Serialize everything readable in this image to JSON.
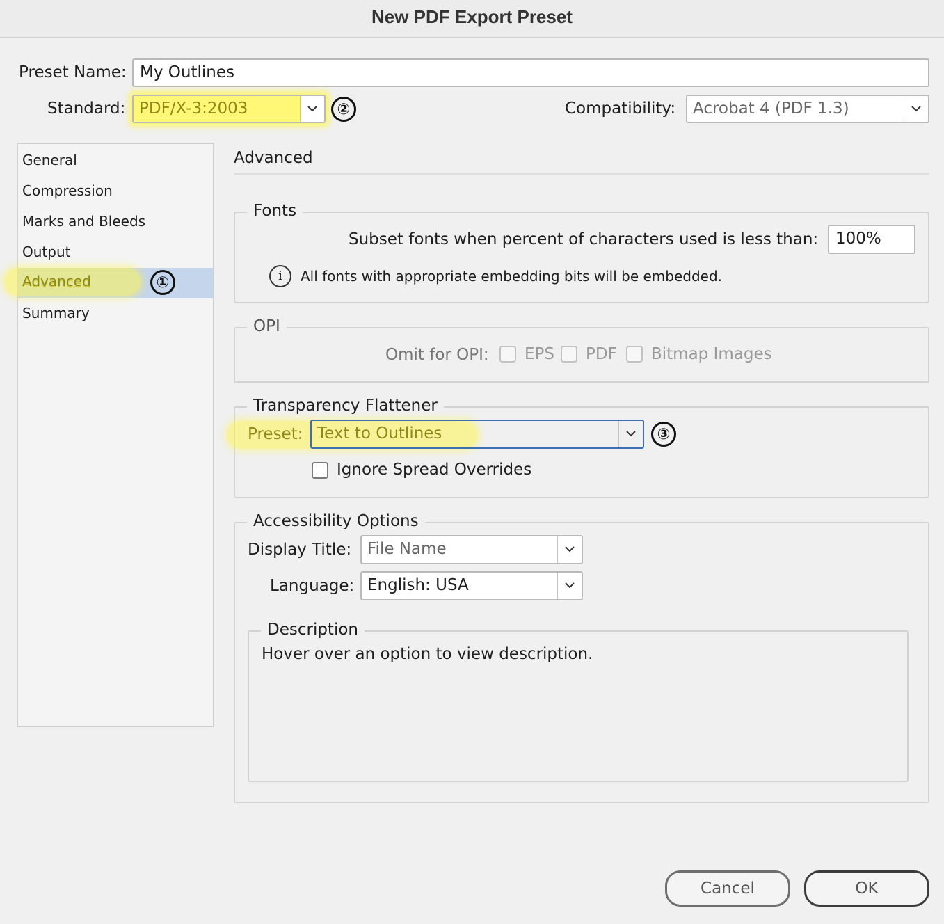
{
  "window": {
    "title": "New PDF Export Preset"
  },
  "preset_name": {
    "label": "Preset Name:",
    "value": "My Outlines"
  },
  "standard": {
    "label": "Standard:",
    "value": "PDF/X-3:2003",
    "badge": "②"
  },
  "compatibility": {
    "label": "Compatibility:",
    "value": "Acrobat 4 (PDF 1.3)"
  },
  "sidebar": {
    "items": [
      {
        "label": "General"
      },
      {
        "label": "Compression"
      },
      {
        "label": "Marks and Bleeds"
      },
      {
        "label": "Output"
      },
      {
        "label": "Advanced",
        "badge": "①",
        "selected": true
      },
      {
        "label": "Summary"
      }
    ]
  },
  "panel": {
    "heading": "Advanced"
  },
  "fonts": {
    "legend": "Fonts",
    "subset_label": "Subset fonts when percent of characters used is less than:",
    "subset_value": "100%",
    "info_text": "All fonts with appropriate embedding bits will be embedded.",
    "info_icon": "info-icon"
  },
  "opi": {
    "legend": "OPI",
    "omit_label": "Omit for OPI:",
    "options": [
      {
        "label": "EPS",
        "checked": false
      },
      {
        "label": "PDF",
        "checked": false
      },
      {
        "label": "Bitmap Images",
        "checked": false
      }
    ]
  },
  "transparency": {
    "legend": "Transparency Flattener",
    "preset_label": "Preset:",
    "preset_value": "Text to Outlines",
    "badge": "③",
    "ignore_label": "Ignore Spread Overrides",
    "ignore_checked": false
  },
  "accessibility": {
    "legend": "Accessibility Options",
    "display_title_label": "Display Title:",
    "display_title_value": "File Name",
    "language_label": "Language:",
    "language_value": "English: USA"
  },
  "description": {
    "legend": "Description",
    "text": "Hover over an option to view description."
  },
  "buttons": {
    "cancel": "Cancel",
    "ok": "OK"
  },
  "colors": {
    "highlight": "#fff650",
    "selection": "#c4d5ec",
    "focus_border": "#3d6fb8"
  }
}
